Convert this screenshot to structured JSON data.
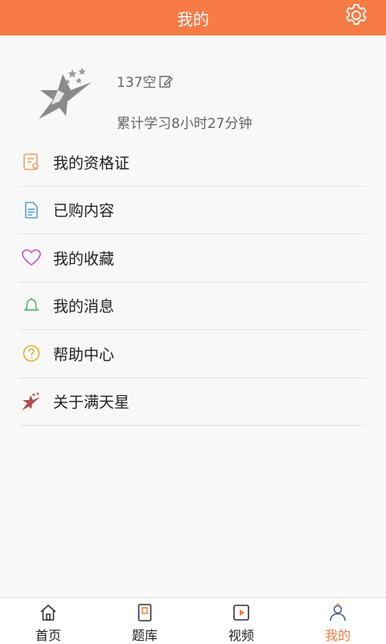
{
  "header": {
    "title": "我的",
    "settings_icon": "gear-icon"
  },
  "profile": {
    "username": "137空",
    "study_time": "累计学习8小时27分钟"
  },
  "menu": [
    {
      "label": "我的资格证",
      "icon": "certificate-icon",
      "color": "#f0a060"
    },
    {
      "label": "已购内容",
      "icon": "document-icon",
      "color": "#5a9fd6"
    },
    {
      "label": "我的收藏",
      "icon": "heart-icon",
      "color": "#d04fc0"
    },
    {
      "label": "我的消息",
      "icon": "bell-icon",
      "color": "#58b868"
    },
    {
      "label": "帮助中心",
      "icon": "help-icon",
      "color": "#e8b030"
    },
    {
      "label": "关于满天星",
      "icon": "star-logo-icon",
      "color": "#b25050"
    }
  ],
  "tabbar": {
    "tabs": [
      {
        "label": "首页",
        "icon": "home-icon"
      },
      {
        "label": "题库",
        "icon": "book-icon"
      },
      {
        "label": "视频",
        "icon": "video-icon"
      },
      {
        "label": "我的",
        "icon": "user-icon",
        "active": true
      }
    ]
  },
  "colors": {
    "accent": "#f87a45"
  }
}
